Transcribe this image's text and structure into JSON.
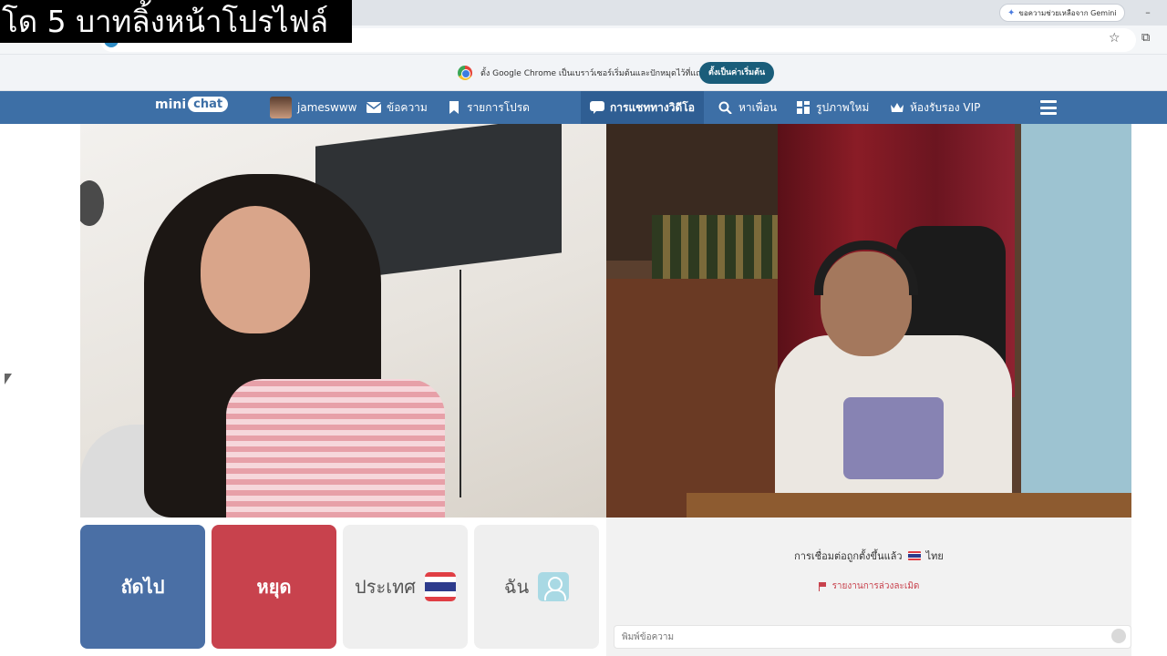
{
  "browser": {
    "gemini_button": "ขอความช่วยเหลือจาก Gemini",
    "minimize": "–",
    "infobar_text": "ตั้ง Google Chrome เป็นเบราว์เซอร์เริ่มต้นและปักหมุดไว้ที่แถบงาน",
    "infobar_button": "ตั้งเป็นค่าเริ่มต้น"
  },
  "caption": "โด 5 บาทลิ้งหน้าโปรไฟล์",
  "nav": {
    "logo_left": "mini",
    "logo_right": "chat",
    "username": "jameswww",
    "messages": "ข้อความ",
    "favorites": "รายการโปรด",
    "video_chat": "การแชททางวิดีโอ",
    "find_friends": "หาเพื่อน",
    "new_photos": "รูปภาพใหม่",
    "vip_room": "ห้องรับรอง VIP"
  },
  "controls": {
    "next": "ถัดไป",
    "stop": "หยุด",
    "country": "ประเทศ",
    "me": "ฉัน"
  },
  "chat": {
    "status": "การเชื่อมต่อถูกตั้งขึ้นแล้ว",
    "country": "ไทย",
    "report": "รายงานการล่วงละเมิด",
    "input_placeholder": "พิมพ์ข้อความ"
  },
  "colors": {
    "nav_bg": "#3d6fa6",
    "next_btn": "#4a6fa5",
    "stop_btn": "#c8424d"
  }
}
